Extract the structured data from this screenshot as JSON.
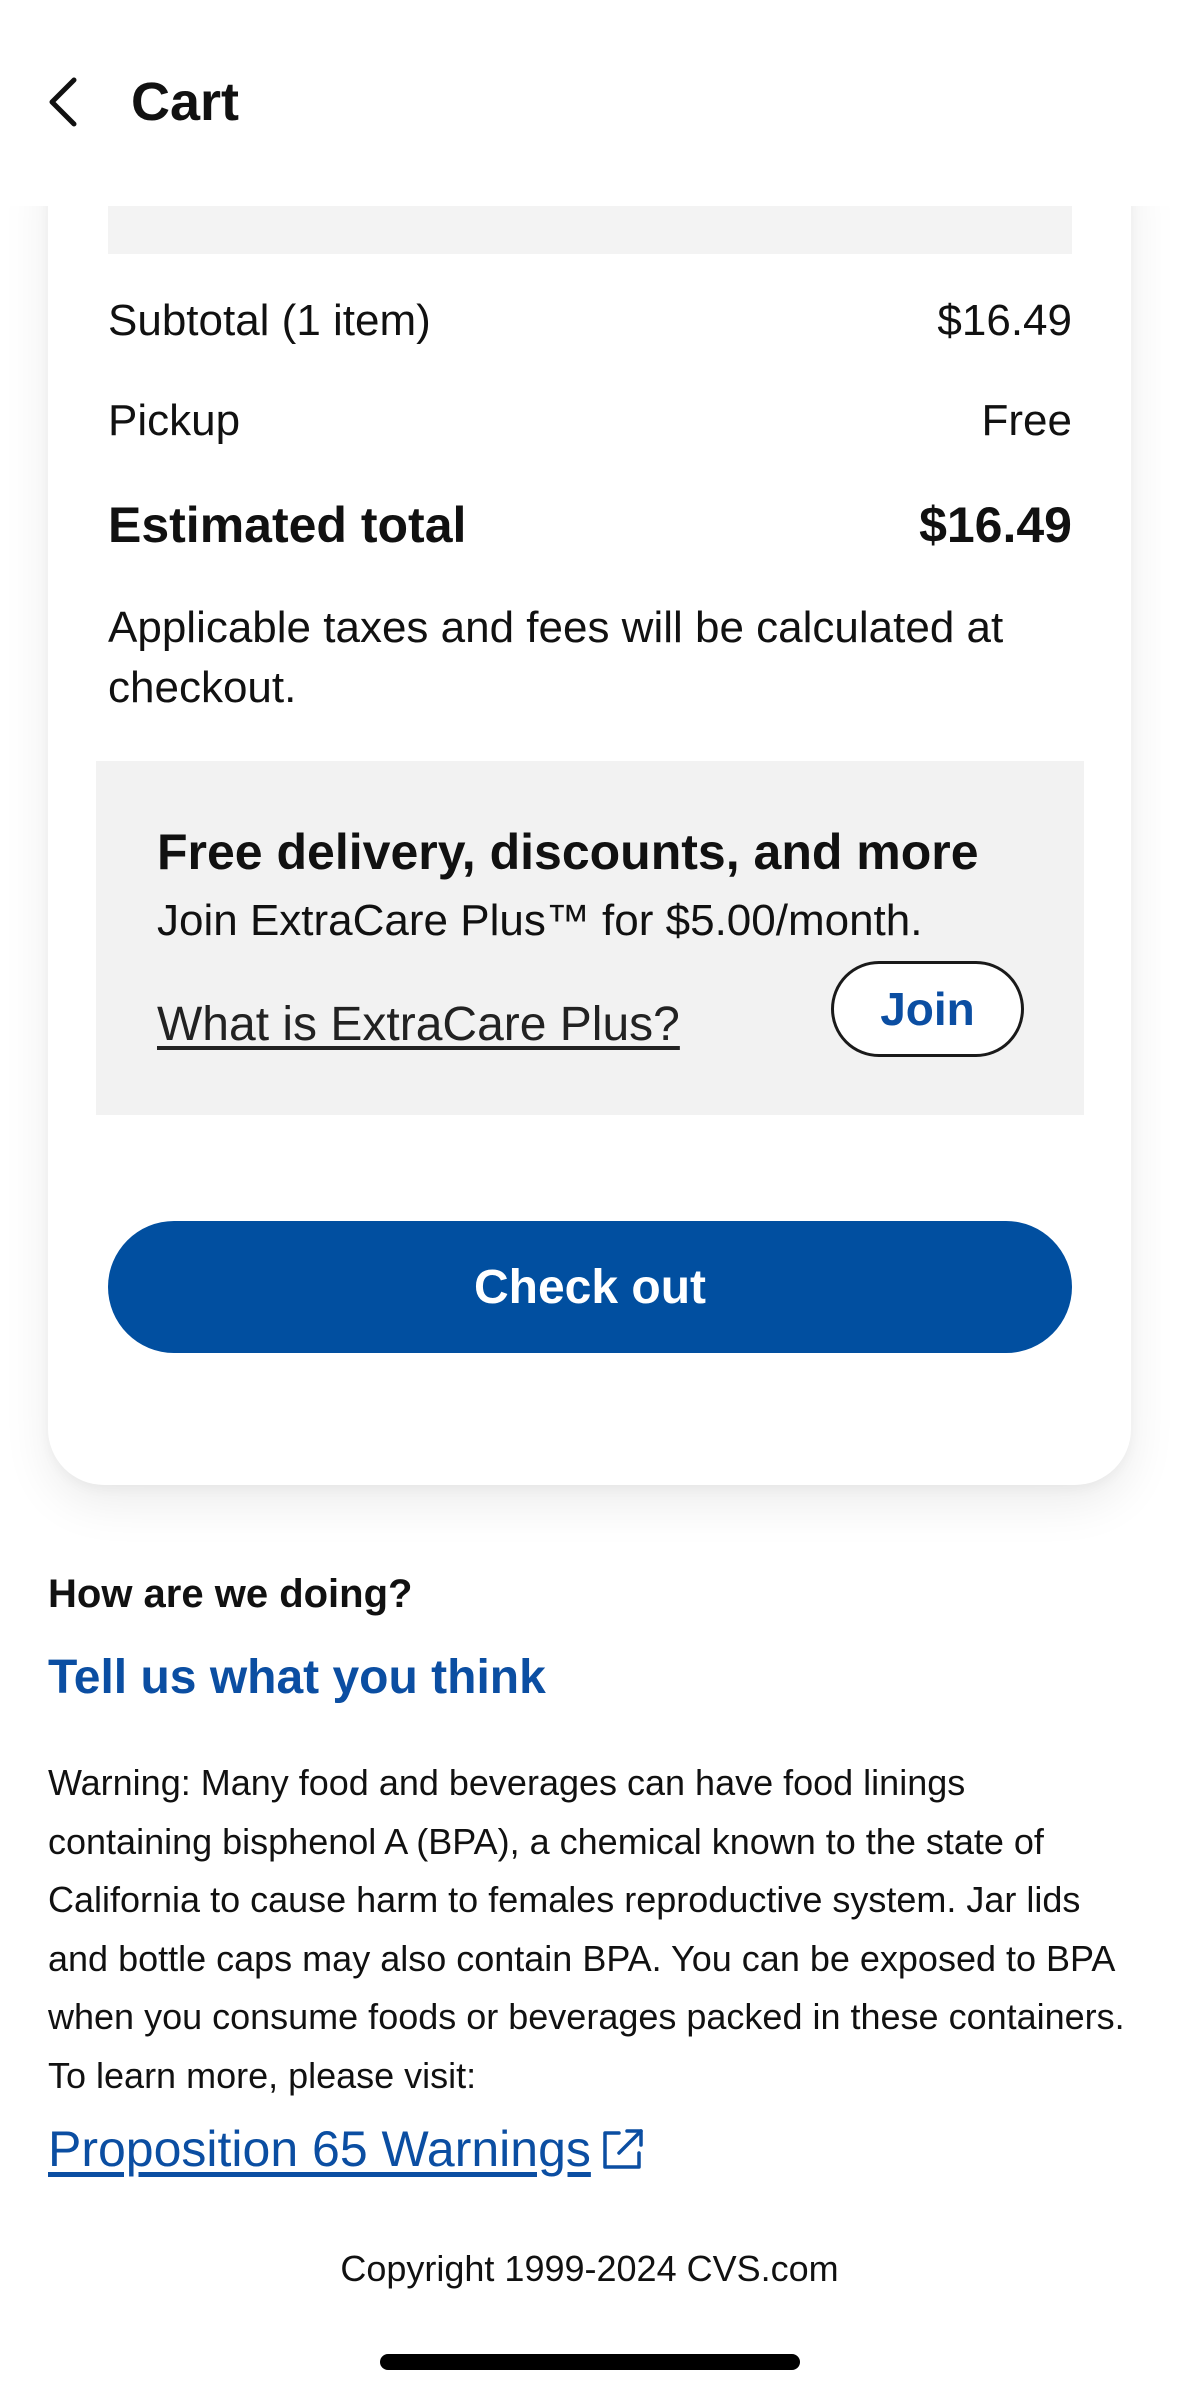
{
  "header": {
    "title": "Cart",
    "back_icon": "chevron-left-icon"
  },
  "summary": {
    "subtotal_label": "Subtotal (1 item)",
    "subtotal_value": "$16.49",
    "pickup_label": "Pickup",
    "pickup_value": "Free",
    "total_label": "Estimated total",
    "total_value": "$16.49",
    "tax_note": "Applicable taxes and fees will be calculated at checkout."
  },
  "promo": {
    "title": "Free delivery, discounts, and more",
    "subtitle": "Join ExtraCare Plus™ for $5.00/month.",
    "link": "What is ExtraCare Plus?",
    "join_label": "Join"
  },
  "checkout_label": "Check out",
  "feedback": {
    "question": "How are we doing?",
    "link": "Tell us what you think"
  },
  "warning_text": "Warning: Many food and beverages can have food linings containing bisphenol A (BPA), a chemical known to the state of California to cause harm to females reproductive system. Jar lids and bottle caps may also contain BPA. You can be exposed to BPA when you consume foods or beverages packed in these containers. To learn more, please visit:",
  "prop65_link": "Proposition 65 Warnings",
  "copyright": "Copyright 1999-2024 CVS.com",
  "colors": {
    "brand_blue": "#014fa0",
    "link_blue": "#0b4ea2",
    "promo_bg": "#f2f2f2"
  }
}
